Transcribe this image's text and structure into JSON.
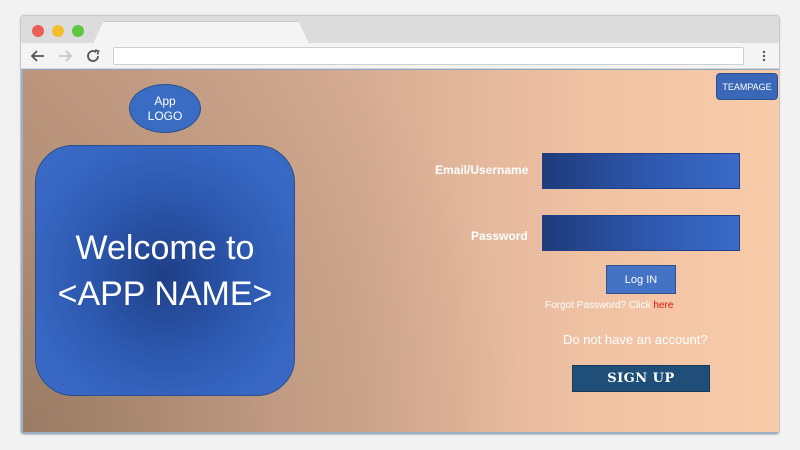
{
  "browser": {
    "icons": {
      "back": "arrow-left-icon",
      "forward": "arrow-right-icon",
      "reload": "reload-icon",
      "menu": "kebab-menu-icon"
    },
    "address": ""
  },
  "header": {
    "teampage_label": "TEAMPAGE"
  },
  "logo": {
    "line1": "App",
    "line2": "LOGO"
  },
  "welcome": {
    "line1": "Welcome to",
    "line2": "<APP NAME>"
  },
  "login_form": {
    "email_label": "Email/Username",
    "password_label": "Password",
    "email_value": "",
    "password_value": "",
    "login_label": "Log IN",
    "forgot_text": "Forgot Password? Click ",
    "forgot_link": "here",
    "no_account_text": "Do not have an account?",
    "signup_label": "SIGN UP"
  },
  "colors": {
    "accent_blue": "#3a6bc6",
    "signup_blue": "#1f4e79",
    "link_red": "#e3140f",
    "background_peach": "#f8cba9"
  }
}
